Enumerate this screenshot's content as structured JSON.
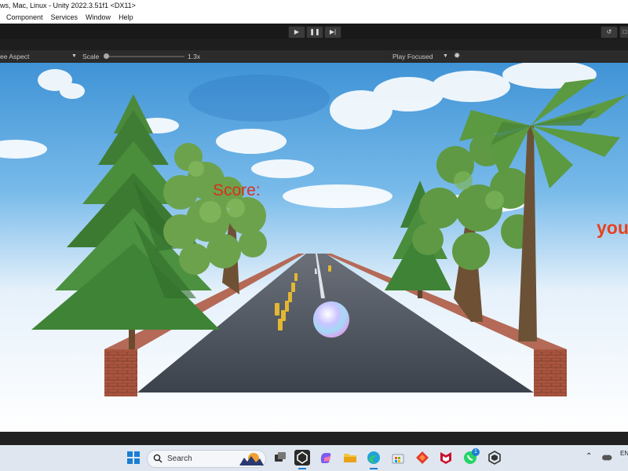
{
  "window": {
    "title": "ws, Mac, Linux - Unity 2022.3.51f1 <DX11>"
  },
  "menu": [
    "Component",
    "Services",
    "Window",
    "Help"
  ],
  "game_view": {
    "aspect_label": "ee Aspect",
    "scale_label": "Scale",
    "scale_value": "1.3x",
    "scale_fraction": 0.03,
    "play_mode": "Play Focused"
  },
  "hud": {
    "score_label": "Score:",
    "message_partial": "you"
  },
  "taskbar": {
    "search_label": "Search",
    "notification_count": "1",
    "lang": "EN",
    "pinned_icons": [
      "windows-start-icon",
      "task-view-icon",
      "unity-hub-icon",
      "copilot-icon",
      "file-explorer-icon",
      "edge-icon",
      "microsoft-store-icon",
      "red-app-icon",
      "mcafee-icon",
      "whatsapp-icon",
      "unity-icon"
    ]
  },
  "colors": {
    "score": "#d7301e",
    "message": "#e8401c",
    "sky": "#5aa8e0",
    "road": "#454c55"
  }
}
